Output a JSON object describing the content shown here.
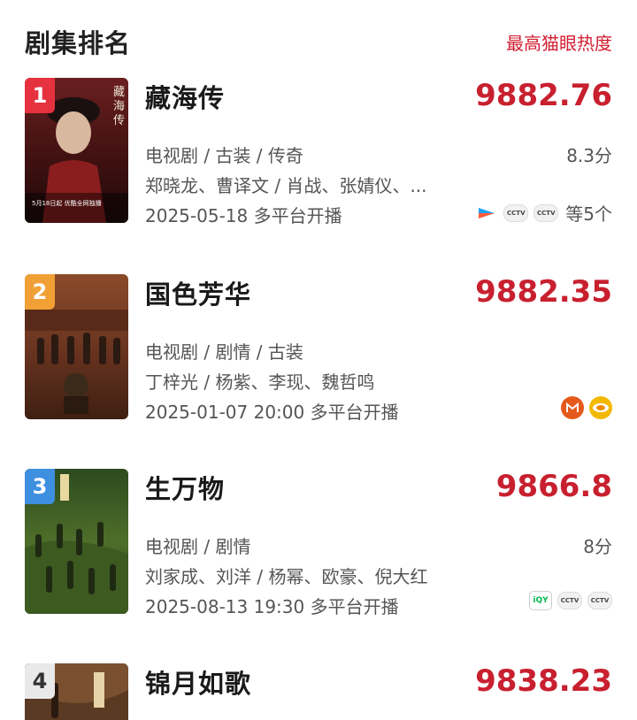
{
  "header": {
    "title": "剧集排名",
    "sort_label": "最高猫眼热度"
  },
  "items": [
    {
      "rank": "1",
      "title": "藏海传",
      "heat": "9882.76",
      "genre": "电视剧 / 古装 / 传奇",
      "score": "8.3分",
      "cast": "郑晓龙、曹译文 / 肖战、张婧仪、...",
      "release": "2025-05-18 多平台开播",
      "platforms": [
        "youku-icon",
        "cctv-icon",
        "cctv-icon"
      ],
      "platforms_more": "等5个",
      "poster_text": [
        "藏",
        "海",
        "传",
        "5月18日起 优酷全网独播"
      ]
    },
    {
      "rank": "2",
      "title": "国色芳华",
      "heat": "9882.35",
      "genre": "电视剧 / 剧情 / 古装",
      "score": "",
      "cast": "丁梓光 / 杨紫、李现、魏哲鸣",
      "release": "2025-01-07 20:00 多平台开播",
      "platforms": [
        "mgtv-icon",
        "hunan-tv-icon"
      ],
      "platforms_more": ""
    },
    {
      "rank": "3",
      "title": "生万物",
      "heat": "9866.8",
      "genre": "电视剧 / 剧情",
      "score": "8分",
      "cast": "刘家成、刘洋 / 杨幂、欧豪、倪大红",
      "release": "2025-08-13 19:30 多平台开播",
      "platforms": [
        "iqiyi-icon",
        "cctv-icon",
        "cctv-icon"
      ],
      "platforms_more": ""
    },
    {
      "rank": "4",
      "title": "锦月如歌",
      "heat": "9838.23"
    }
  ],
  "colors": {
    "accent": "#c8202f",
    "rank1": "#e5323e",
    "rank2": "#f0a035",
    "rank3": "#3e8fe0"
  }
}
